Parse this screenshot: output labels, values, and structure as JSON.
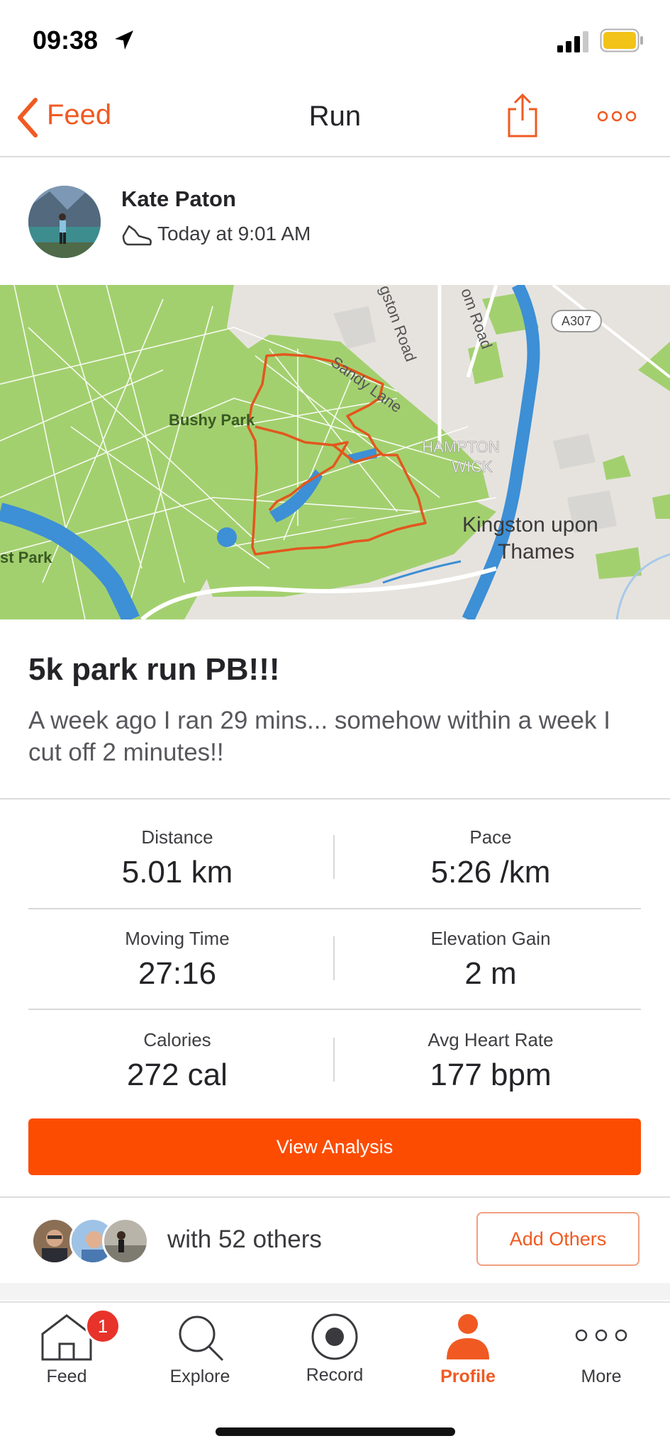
{
  "status_bar": {
    "time": "09:38"
  },
  "nav": {
    "back_label": "Feed",
    "title": "Run"
  },
  "athlete": {
    "name": "Kate Paton",
    "timestamp": "Today at 9:01 AM"
  },
  "map": {
    "labels": {
      "bushy_park": "Bushy Park",
      "sandy_lane": "Sandy Lane",
      "road1": "gston Road",
      "road2": "om Road",
      "a307": "A307",
      "hampton": "HAMPTON",
      "wick": "WICK",
      "kingston1": "Kingston upon",
      "kingston2": "Thames",
      "park_left": "st Park"
    }
  },
  "activity": {
    "title": "5k park run PB!!!",
    "description": "A week ago I ran 29 mins... somehow within a week I cut off 2 minutes!!"
  },
  "stats": [
    {
      "label": "Distance",
      "value": "5.01 km"
    },
    {
      "label": "Pace",
      "value": "5:26 /km"
    },
    {
      "label": "Moving Time",
      "value": "27:16"
    },
    {
      "label": "Elevation Gain",
      "value": "2 m"
    },
    {
      "label": "Calories",
      "value": "272 cal"
    },
    {
      "label": "Avg Heart Rate",
      "value": "177 bpm"
    }
  ],
  "analysis_button": "View Analysis",
  "group": {
    "with_text": "with 52 others",
    "add_button": "Add Others"
  },
  "tabbar": {
    "items": [
      {
        "label": "Feed",
        "badge": "1"
      },
      {
        "label": "Explore"
      },
      {
        "label": "Record"
      },
      {
        "label": "Profile",
        "active": true
      },
      {
        "label": "More"
      }
    ],
    "active_color": "#f05a22"
  },
  "colors": {
    "accent": "#fc4c02",
    "route": "#e2571e",
    "park": "#9fcf6e",
    "water": "#3d8fd6"
  }
}
